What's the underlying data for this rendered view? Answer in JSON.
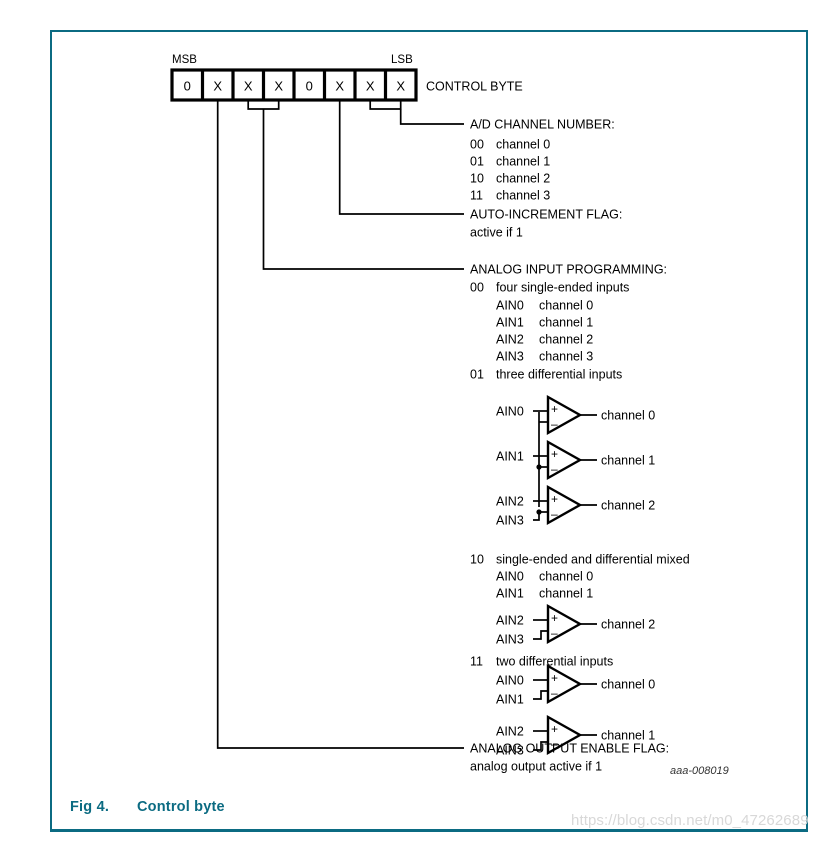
{
  "figure": {
    "caption_label": "Fig 4.",
    "caption_title": "Control byte",
    "doc_id": "aaa-008019",
    "watermark": "https://blog.csdn.net/m0_47262689",
    "frame_color": "#0b6b82"
  },
  "control_byte": {
    "msb_label": "MSB",
    "lsb_label": "LSB",
    "name": "CONTROL BYTE",
    "bits": [
      "0",
      "X",
      "X",
      "X",
      "0",
      "X",
      "X",
      "X"
    ]
  },
  "sections": {
    "ad_channel": {
      "title": "A/D CHANNEL NUMBER:",
      "rows": [
        {
          "code": "00",
          "text": "channel 0"
        },
        {
          "code": "01",
          "text": "channel 1"
        },
        {
          "code": "10",
          "text": "channel 2"
        },
        {
          "code": "11",
          "text": "channel 3"
        }
      ]
    },
    "auto_increment": {
      "title": "AUTO-INCREMENT FLAG:",
      "note": "active if 1"
    },
    "analog_input": {
      "title": "ANALOG INPUT PROGRAMMING:",
      "mode_00": {
        "code": "00",
        "text": "four single-ended inputs",
        "rows": [
          {
            "ain": "AIN0",
            "channel": "channel 0"
          },
          {
            "ain": "AIN1",
            "channel": "channel 1"
          },
          {
            "ain": "AIN2",
            "channel": "channel 2"
          },
          {
            "ain": "AIN3",
            "channel": "channel 3"
          }
        ]
      },
      "mode_01": {
        "code": "01",
        "text": "three differential inputs",
        "amps": [
          {
            "plus": "AIN0",
            "minus": "",
            "out": "channel 0",
            "sign_plus": "+",
            "sign_minus": "–"
          },
          {
            "plus": "AIN1",
            "minus": "",
            "out": "channel 1",
            "sign_plus": "+",
            "sign_minus": "–"
          },
          {
            "plus": "AIN2",
            "minus": "AIN3",
            "out": "channel 2",
            "sign_plus": "+",
            "sign_minus": "–"
          }
        ]
      },
      "mode_10": {
        "code": "10",
        "text": "single-ended and differential mixed",
        "rows": [
          {
            "ain": "AIN0",
            "channel": "channel 0"
          },
          {
            "ain": "AIN1",
            "channel": "channel 1"
          }
        ],
        "amps": [
          {
            "plus": "AIN2",
            "minus": "AIN3",
            "out": "channel 2",
            "sign_plus": "+",
            "sign_minus": "–"
          }
        ]
      },
      "mode_11": {
        "code": "11",
        "text": "two differential inputs",
        "amps": [
          {
            "plus": "AIN0",
            "minus": "AIN1",
            "out": "channel 0",
            "sign_plus": "+",
            "sign_minus": "–"
          },
          {
            "plus": "AIN2",
            "minus": "AIN3",
            "out": "channel 1",
            "sign_plus": "+",
            "sign_minus": "–"
          }
        ]
      }
    },
    "analog_output": {
      "title": "ANALOG OUTPUT ENABLE FLAG:",
      "note": "analog output active if 1"
    }
  }
}
